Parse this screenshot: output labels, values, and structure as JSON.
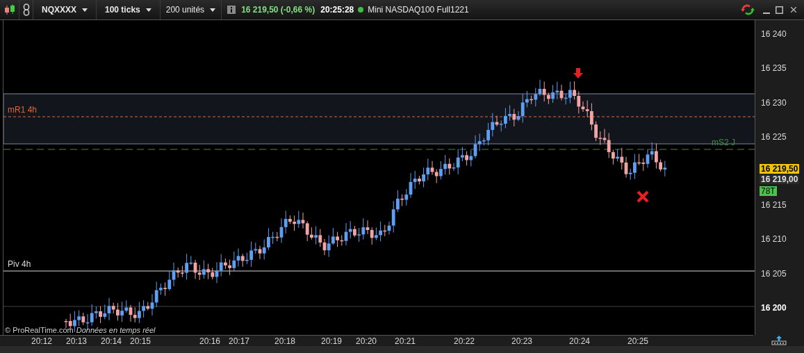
{
  "toolbar": {
    "instrument": "NQXXXX",
    "interval": "100 ticks",
    "units": "200 unités",
    "quote": "16 219,50 (-0,66 %)",
    "time": "20:25:28",
    "feed_connected": true,
    "product": "Mini NASDAQ100 Full1221"
  },
  "chart": {
    "levels": [
      {
        "label": "mR1 4h",
        "color": "#e0673a"
      },
      {
        "label": "mS2 J",
        "color": "#3a8f3a"
      },
      {
        "label": "Piv 4h",
        "color": "#d8d8d8"
      }
    ],
    "credit": "© ProRealTime.com",
    "data_note": "Données en temps réel",
    "price_ticks": [
      {
        "label": "16 240",
        "bold": false
      },
      {
        "label": "16 235",
        "bold": false
      },
      {
        "label": "16 230",
        "bold": false
      },
      {
        "label": "16 225",
        "bold": false
      },
      {
        "label": "16 215",
        "bold": false
      },
      {
        "label": "16 210",
        "bold": false
      },
      {
        "label": "16 205",
        "bold": false
      },
      {
        "label": "16 200",
        "bold": true
      }
    ],
    "price_badges": [
      {
        "label": "16 219,50",
        "kind": "last"
      },
      {
        "label": "16 219,00",
        "kind": "bid"
      },
      {
        "label": "78T",
        "kind": "ticks"
      }
    ],
    "time_labels": [
      "20:12",
      "20:13",
      "20:14",
      "20:15",
      "20:16",
      "20:17",
      "20:18",
      "20:19",
      "20:20",
      "20:21",
      "20:22",
      "20:23",
      "20:24",
      "20:25"
    ]
  }
}
